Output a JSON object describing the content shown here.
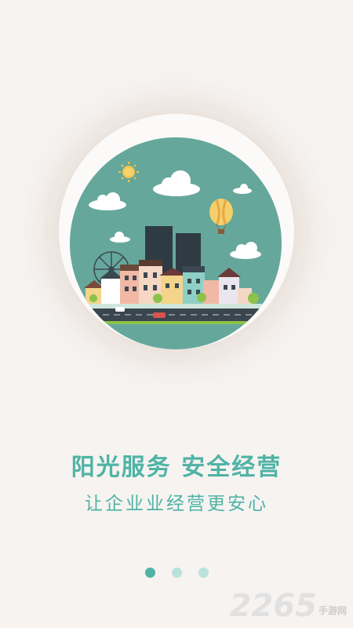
{
  "intro": {
    "headline": "阳光服务 安全经营",
    "subline": "让企业业经营更安心"
  },
  "pager": {
    "count": 3,
    "active": 1
  },
  "watermark": {
    "number": "2265",
    "suffix": "手游网"
  },
  "colors": {
    "accent": "#4fb3a5",
    "dot_inactive": "#b9e2dc",
    "background": "#f6f3f1",
    "circle": "#66a79c"
  }
}
